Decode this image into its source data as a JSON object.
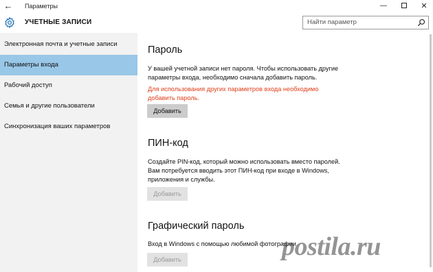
{
  "window": {
    "back_icon": "back-arrow-icon",
    "title": "Параметры",
    "minimize_icon": "minimize-icon",
    "maximize_icon": "maximize-icon",
    "close_icon": "close-icon"
  },
  "header": {
    "icon": "gear-icon",
    "title": "УЧЕТНЫЕ ЗАПИСИ",
    "search_placeholder": "Найти параметр",
    "search_icon": "search-icon"
  },
  "sidebar": {
    "items": [
      {
        "label": "Электронная почта и учетные записи",
        "active": false
      },
      {
        "label": "Параметры входа",
        "active": true
      },
      {
        "label": "Рабочий доступ",
        "active": false
      },
      {
        "label": "Семья и другие пользователи",
        "active": false
      },
      {
        "label": "Синхронизация ваших параметров",
        "active": false
      }
    ]
  },
  "sections": {
    "password": {
      "title": "Пароль",
      "text": "У вашей учетной записи нет пароля. Чтобы использовать другие параметры входа, необходимо сначала добавить пароль.",
      "warning": "Для использования других параметров входа необходимо добавить пароль.",
      "button": "Добавить"
    },
    "pin": {
      "title": "ПИН-код",
      "text": "Создайте PIN-код, который можно использовать вместо паролей. Вам потребуется вводить этот ПИН-код при входе в Windows, приложения и службы.",
      "button": "Добавить"
    },
    "picture_password": {
      "title": "Графический пароль",
      "text": "Вход в Windows с помощью любимой фотографии",
      "button": "Добавить"
    }
  },
  "watermark": "postila.ru",
  "colors": {
    "accent_selected": "#99c7e7",
    "warning_text": "#e0401c",
    "sidebar_bg": "#f2f2f2",
    "button_bg": "#cccccc",
    "button_disabled_bg": "#e2e2e2"
  }
}
